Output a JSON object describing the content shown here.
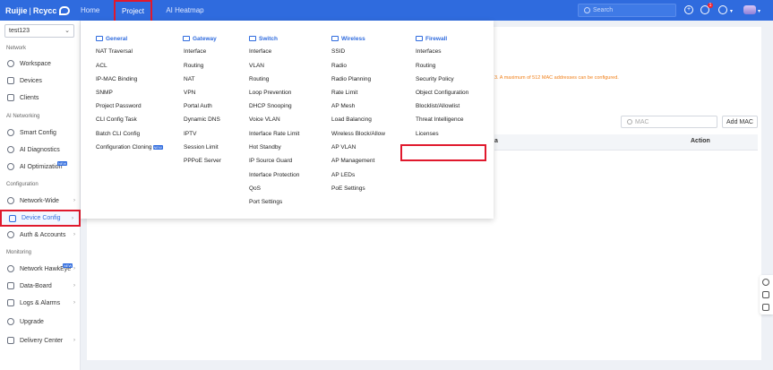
{
  "brand": {
    "name": "Ruijie",
    "sub": "Rcycc"
  },
  "topnav": {
    "home": "Home",
    "project": "Project",
    "heatmap": "AI Heatmap"
  },
  "search": {
    "placeholder": "Search"
  },
  "notifications": {
    "count": "1"
  },
  "sidebar": {
    "project": "test123",
    "sections": {
      "network": "Network",
      "ai": "AI Networking",
      "config": "Configuration",
      "monitoring": "Monitoring"
    },
    "items": [
      {
        "label": "Workspace"
      },
      {
        "label": "Devices"
      },
      {
        "label": "Clients"
      },
      {
        "label": "Smart Config"
      },
      {
        "label": "AI Diagnostics"
      },
      {
        "label": "AI Optimization"
      },
      {
        "label": "Network-Wide"
      },
      {
        "label": "Device Config"
      },
      {
        "label": "Auth & Accounts"
      },
      {
        "label": "Network HawkEye"
      },
      {
        "label": "Data-Board"
      },
      {
        "label": "Logs & Alarms"
      },
      {
        "label": "Upgrade"
      },
      {
        "label": "Delivery Center"
      }
    ]
  },
  "menu": {
    "general": {
      "title": "General",
      "items": [
        "NAT Traversal",
        "ACL",
        "IP-MAC Binding",
        "SNMP",
        "Project Password",
        "CLI Config Task",
        "Batch CLI Config",
        "Configuration Cloning"
      ]
    },
    "gateway": {
      "title": "Gateway",
      "items": [
        "Interface",
        "Routing",
        "NAT",
        "VPN",
        "Portal Auth",
        "Dynamic DNS",
        "IPTV",
        "Session Limit",
        "PPPoE Server"
      ]
    },
    "switch": {
      "title": "Switch",
      "items": [
        "Interface",
        "VLAN",
        "Routing",
        "Loop Prevention",
        "DHCP Snooping",
        "Voice VLAN",
        "Interface Rate Limit",
        "Hot Standby",
        "IP Source Guard",
        "Interface Protection",
        "QoS",
        "Port Settings"
      ]
    },
    "wireless": {
      "title": "Wireless",
      "items": [
        "SSID",
        "Radio",
        "Radio Planning",
        "Rate Limit",
        "AP Mesh",
        "Load Balancing",
        "Wireless Block/Allow",
        "AP VLAN",
        "AP Management",
        "AP LEDs",
        "PoE Settings"
      ]
    },
    "firewall": {
      "title": "Firewall",
      "items": [
        "Interfaces",
        "Routing",
        "Security Policy",
        "Object Configuration",
        "Blocklist/Allowlist",
        "Threat Intelligence",
        "Licenses"
      ]
    }
  },
  "content": {
    "warning": "3. A maximum of 512 MAC addresses can be configured.",
    "mac_placeholder": "MAC",
    "add_mac": "Add MAC",
    "col_partial": "a",
    "col_action": "Action"
  },
  "new_tag": "NEW",
  "colors": {
    "brand": "#2f6bde",
    "highlight": "#e0192d",
    "warning": "#f07f18"
  }
}
